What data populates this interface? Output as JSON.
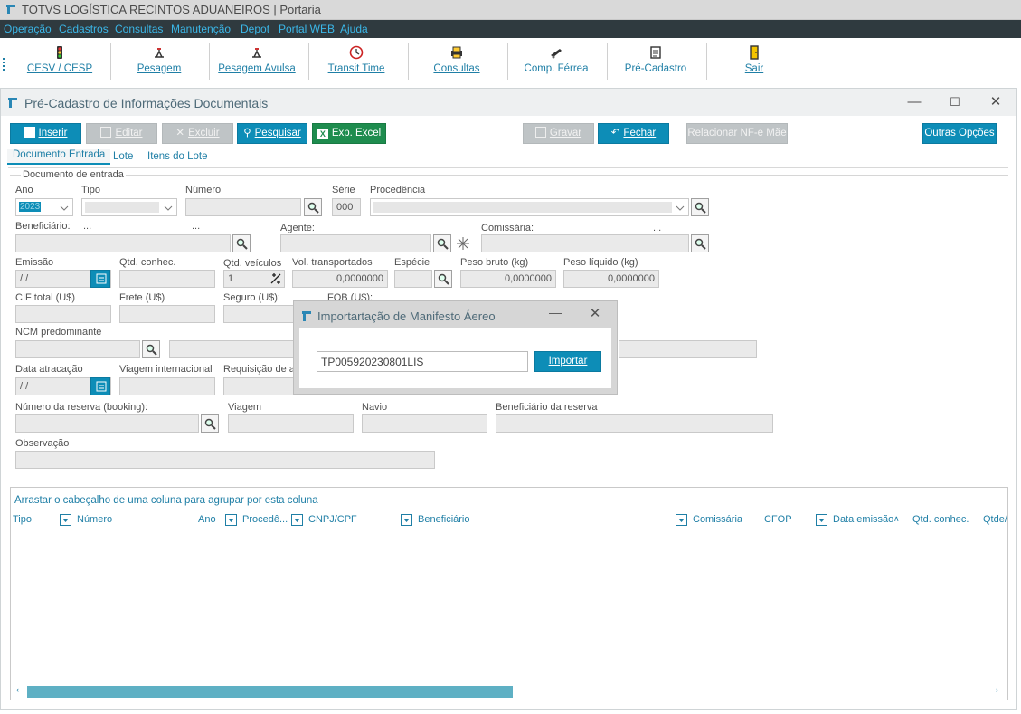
{
  "app": {
    "title": "TOTVS LOGÍSTICA RECINTOS ADUANEIROS | Portaria"
  },
  "menu": [
    "Operação",
    "Cadastros",
    "Consultas",
    "Manutenção",
    "Depot",
    "Portal WEB",
    "Ajuda"
  ],
  "toolbar": [
    {
      "label": "CESV / CESP",
      "icon": "traffic-light-icon"
    },
    {
      "label": "Pesagem",
      "icon": "scale-icon"
    },
    {
      "label": "Pesagem Avulsa",
      "icon": "scale-icon"
    },
    {
      "label": "Transit Time",
      "icon": "clock-icon"
    },
    {
      "label": "Consultas",
      "icon": "printer-icon"
    },
    {
      "label": "Comp. Férrea",
      "icon": "train-icon"
    },
    {
      "label": "Pré-Cadastro",
      "icon": "document-icon"
    },
    {
      "label": "Sair",
      "icon": "exit-door-icon"
    }
  ],
  "window": {
    "title": "Pré-Cadastro de Informações Documentais"
  },
  "actions": {
    "inserir": "Inserir",
    "editar": "Editar",
    "excluir": "Excluir",
    "pesquisar": "Pesquisar",
    "exp_excel": "Exp. Excel",
    "gravar": "Gravar",
    "fechar": "Fechar",
    "relacionar": "Relacionar NF-e Mãe",
    "outras": "Outras Opções"
  },
  "tabs": [
    "Documento Entrada",
    "Lote",
    "Itens do Lote"
  ],
  "form": {
    "group": "Documento de entrada",
    "ano_label": "Ano",
    "ano_value": "2023",
    "tipo_label": "Tipo",
    "numero_label": "Número",
    "serie_label": "Série",
    "serie_value": "000",
    "procedencia_label": "Procedência",
    "beneficiario_label": "Beneficiário:",
    "ellipsis": "...",
    "agente_label": "Agente:",
    "comissaria_label": "Comissária:",
    "emissao_label": "Emissão",
    "emissao_value": " /  /",
    "qtd_conhec_label": "Qtd. conhec.",
    "qtd_veiculos_label": "Qtd. veículos",
    "qtd_veiculos_value": "1",
    "vol_label": "Vol. transportados",
    "vol_value": "0,0000000",
    "especie_label": "Espécie",
    "peso_bruto_label": "Peso bruto (kg)",
    "peso_bruto_value": "0,0000000",
    "peso_liquido_label": "Peso líquido (kg)",
    "peso_liquido_value": "0,0000000",
    "cif_label": "CIF total (U$)",
    "frete_label": "Frete (U$)",
    "seguro_label": "Seguro (U$):",
    "fob_label": "FOB (U$):",
    "ncm_label": "NCM predominante",
    "data_atracacao_label": "Data atracação",
    "data_atracacao_value": " /  /",
    "viagem_int_label": "Viagem internacional",
    "requisicao_label": "Requisição de at",
    "booking_label": "Número da reserva (booking):",
    "viagem_label": "Viagem",
    "navio_label": "Navio",
    "benef_reserva_label": "Beneficiário da reserva",
    "observacao_label": "Observação"
  },
  "grid": {
    "group_hint": "Arrastar o cabeçalho de uma coluna para agrupar por esta coluna",
    "columns": [
      "Tipo",
      "Número",
      "Ano",
      "Procedê...",
      "CNPJ/CPF",
      "Beneficiário",
      "Comissária",
      "CFOP",
      "Data emissão",
      "Qtd. conhec.",
      "Qtde/"
    ]
  },
  "dialog": {
    "title": "Importartação de Manifesto Áereo",
    "input_value": "TP005920230801LIS",
    "button": "Importar"
  },
  "colors": {
    "accent": "#0d8db7",
    "menubar": "#2f3a3f",
    "link": "#1f7fa6",
    "excel": "#1e8c4e"
  }
}
